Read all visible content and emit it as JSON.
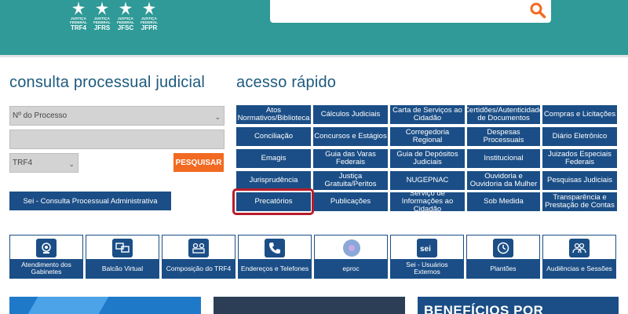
{
  "header": {
    "logos": [
      {
        "top": "JUSTIÇA",
        "mid": "FEDERAL",
        "name": "TRF4"
      },
      {
        "top": "JUSTIÇA",
        "mid": "FEDERAL",
        "name": "JFRS"
      },
      {
        "top": "JUSTIÇA",
        "mid": "FEDERAL",
        "name": "JFSC"
      },
      {
        "top": "JUSTIÇA",
        "mid": "FEDERAL",
        "name": "JFPR"
      }
    ],
    "search": {
      "placeholder": "",
      "icon": "search-icon"
    }
  },
  "consulta": {
    "title": "consulta processual judicial",
    "process_select": "Nº do Processo",
    "text_field": "",
    "court_select": "TRF4",
    "search_button": "PESQUISAR",
    "sei_button": "Sei - Consulta Processual Administrativa"
  },
  "acesso": {
    "title": "acesso rápido",
    "rows": [
      [
        "Atos Normativos/Biblioteca",
        "Cálculos Judiciais",
        "Carta de Serviços ao Cidadão",
        "Certidões/Autenticidade de Documentos",
        "Compras e Licitações"
      ],
      [
        "Conciliação",
        "Concursos e Estágios",
        "Corregedoria Regional",
        "Despesas Processuais",
        "Diário Eletrônico"
      ],
      [
        "Emagis",
        "Guia das Varas Federais",
        "Guia de Depósitos Judiciais",
        "Institucional",
        "Juizados Especiais Federais"
      ],
      [
        "Jurisprudência",
        "Justiça Gratuita/Peritos",
        "NUGEPNAC",
        "Ouvidoria e Ouvidoria da Mulher",
        "Pesquisas Judiciais"
      ],
      [
        "Precatórios",
        "Publicações",
        "Serviço de Informações ao Cidadão",
        "Sob Medida",
        "Transparência e Prestação de Contas"
      ]
    ]
  },
  "services": [
    {
      "label": "Atendimento dos Gabinetes",
      "icon": "attendance-icon"
    },
    {
      "label": "Balcão Virtual",
      "icon": "virtual-desk-icon"
    },
    {
      "label": "Composição do TRF4",
      "icon": "composition-icon"
    },
    {
      "label": "Endereços e Telefones",
      "icon": "phone-icon"
    },
    {
      "label": "eproc",
      "icon": "eproc-icon"
    },
    {
      "label": "Sei - Usuários Externos",
      "icon": "sei-icon"
    },
    {
      "label": "Plantões",
      "icon": "clock-icon"
    },
    {
      "label": "Audiências e Sessões",
      "icon": "people-icon"
    }
  ],
  "banners": {
    "third_text": "BENEFÍCIOS POR"
  }
}
